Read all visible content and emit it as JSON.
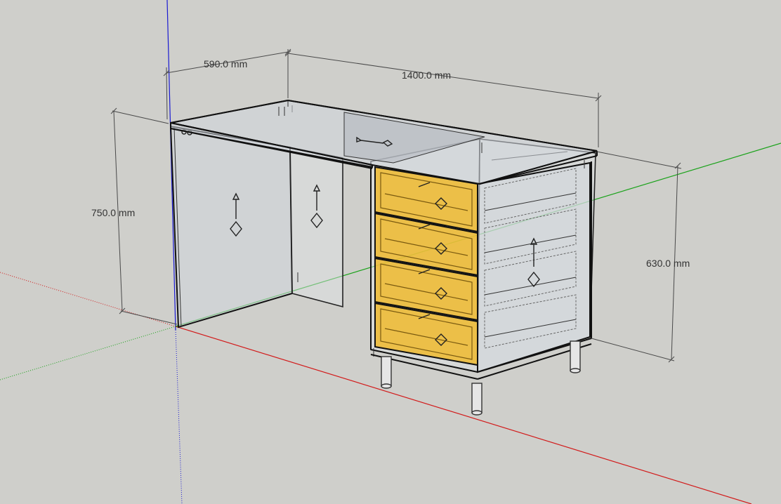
{
  "app": {
    "name": "3D modeling viewport",
    "view": "perspective"
  },
  "model": {
    "name": "desk with 4-drawer pedestal",
    "drawer_count": 4,
    "selected_component": "drawers"
  },
  "dimensions": {
    "width_label": "1400.0 mm",
    "depth_label": "590.0 mm",
    "height_label": "750.0 mm",
    "pedestal_height_label": "630.0 mm"
  },
  "axes": {
    "red_axis_color": "#d21a1a",
    "green_axis_color": "#1aa21a",
    "blue_axis_color": "#1a1ad2"
  },
  "colors": {
    "background": "#cfcfcb",
    "selection_highlight": "#f0b928",
    "panel_glass": "#d2d7de"
  }
}
